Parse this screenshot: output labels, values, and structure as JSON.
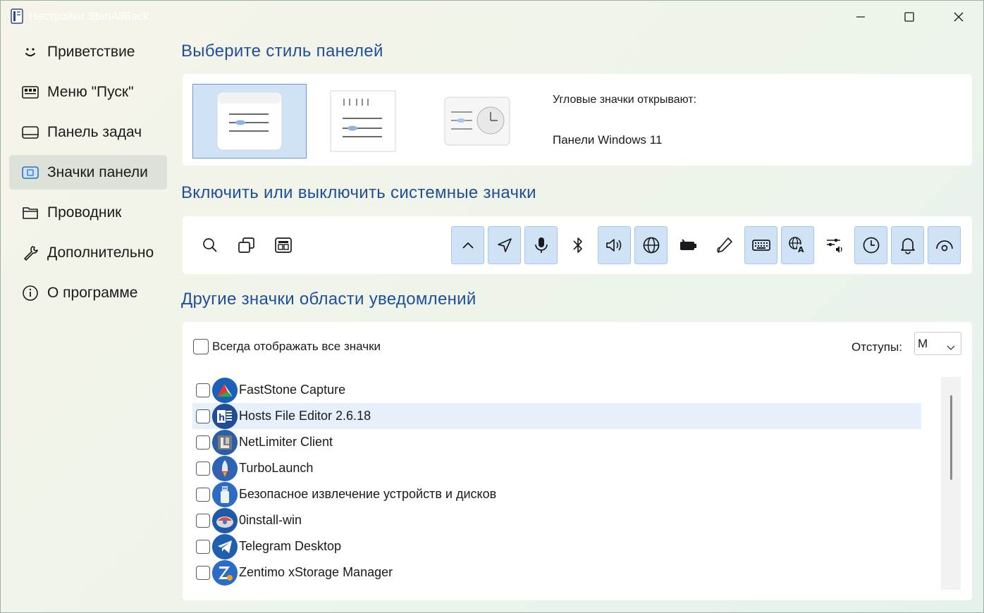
{
  "window": {
    "title": "Настройки StartAllBack"
  },
  "sidebar": {
    "items": [
      {
        "label": "Приветствие",
        "icon": "smile-icon"
      },
      {
        "label": "Меню \"Пуск\"",
        "icon": "start-menu-icon"
      },
      {
        "label": "Панель задач",
        "icon": "taskbar-icon"
      },
      {
        "label": "Значки панели",
        "icon": "tray-icons-icon",
        "active": true
      },
      {
        "label": "Проводник",
        "icon": "folder-icon"
      },
      {
        "label": "Дополнительно",
        "icon": "wrench-icon"
      },
      {
        "label": "О программе",
        "icon": "info-icon"
      }
    ]
  },
  "panel_style": {
    "title": "Выберите стиль панелей",
    "options": [
      "windows11-style",
      "windows10-style",
      "classic-style"
    ],
    "selected": "windows11-style",
    "corner_label": "Угловые значки открывают:",
    "corner_value": "Панели Windows 11"
  },
  "system_icons": {
    "title": "Включить или выключить системные значки",
    "left": [
      {
        "icon": "search-icon",
        "on": false
      },
      {
        "icon": "task-view-icon",
        "on": false
      },
      {
        "icon": "widgets-icon",
        "on": false
      }
    ],
    "right": [
      {
        "icon": "chevron-up-icon",
        "on": true
      },
      {
        "icon": "location-icon",
        "on": true
      },
      {
        "icon": "microphone-icon",
        "on": true
      },
      {
        "icon": "bluetooth-icon",
        "on": false
      },
      {
        "icon": "volume-icon",
        "on": true
      },
      {
        "icon": "network-icon",
        "on": true
      },
      {
        "icon": "battery-icon",
        "on": false
      },
      {
        "icon": "pen-icon",
        "on": false
      },
      {
        "icon": "keyboard-icon",
        "on": true
      },
      {
        "icon": "language-icon",
        "on": true
      },
      {
        "icon": "audio-settings-icon",
        "on": false
      },
      {
        "icon": "clock-icon",
        "on": true
      },
      {
        "icon": "bell-icon",
        "on": true
      },
      {
        "icon": "eye-icon",
        "on": true
      }
    ]
  },
  "notification_icons": {
    "title": "Другие значки области уведомлений",
    "always_show_label": "Всегда отображать все значки",
    "indent_label": "Отступы:",
    "indent_value": "M",
    "apps": [
      {
        "name": "FastStone Capture",
        "icon": "faststone-icon"
      },
      {
        "name": "Hosts File Editor 2.6.18",
        "icon": "hosts-editor-icon",
        "hover": true
      },
      {
        "name": "NetLimiter Client",
        "icon": "netlimiter-icon"
      },
      {
        "name": "TurboLaunch",
        "icon": "turbolaunch-icon"
      },
      {
        "name": "Безопасное извлечение устройств и дисков",
        "icon": "usb-eject-icon"
      },
      {
        "name": "0install-win",
        "icon": "zero-install-icon"
      },
      {
        "name": "Telegram Desktop",
        "icon": "telegram-icon"
      },
      {
        "name": "Zentimo xStorage Manager",
        "icon": "zentimo-icon"
      }
    ]
  }
}
